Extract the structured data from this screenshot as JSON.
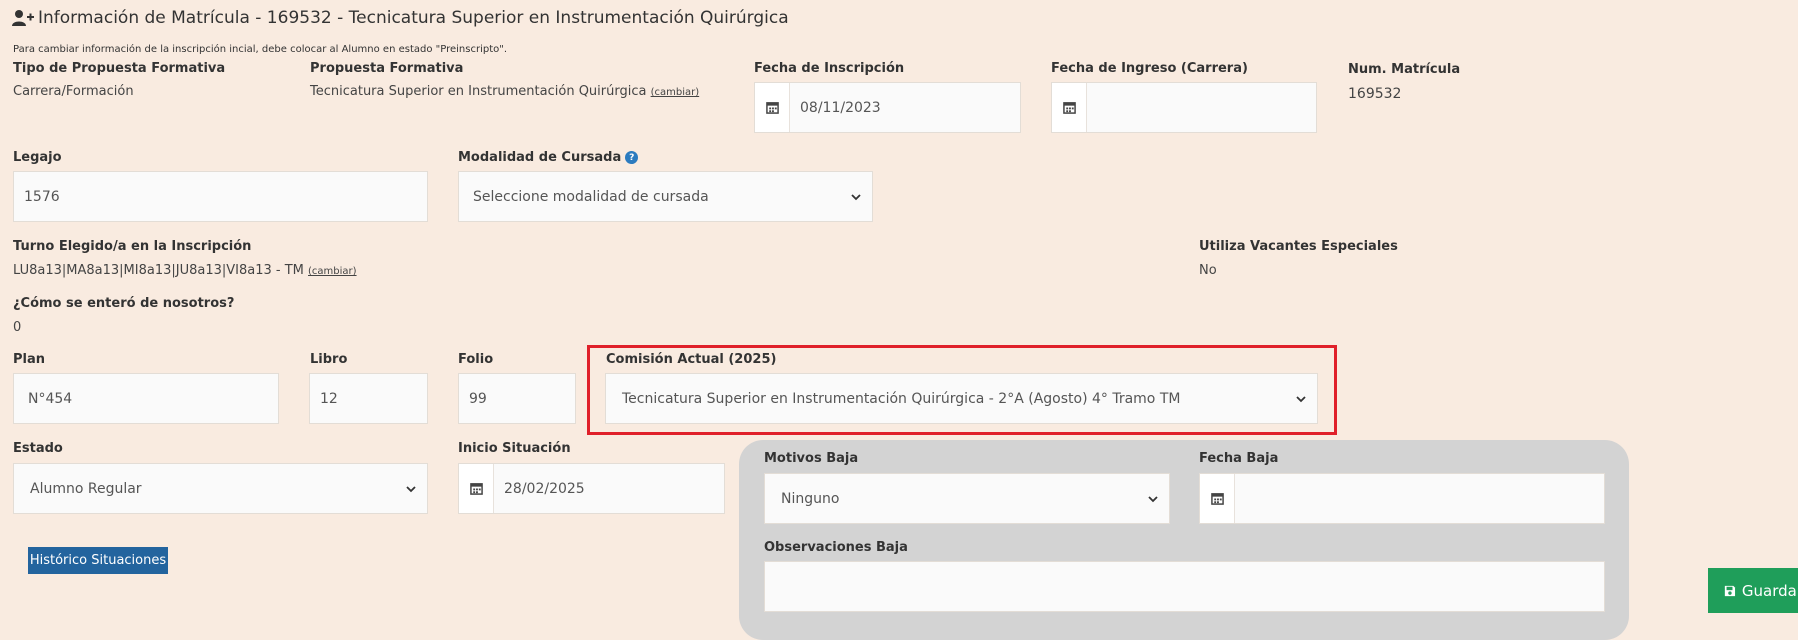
{
  "header": {
    "title": "Información de Matrícula - 169532 - Tecnicatura Superior en Instrumentación Quirúrgica",
    "note": "Para cambiar información de la inscripción incial, debe colocar al Alumno en estado \"Preinscripto\"."
  },
  "tipo_propuesta": {
    "label": "Tipo de Propuesta Formativa",
    "value": "Carrera/Formación"
  },
  "propuesta": {
    "label": "Propuesta Formativa",
    "value": "Tecnicatura Superior en Instrumentación Quirúrgica",
    "link": "(cambiar)"
  },
  "fecha_inscripcion": {
    "label": "Fecha de Inscripción",
    "value": "08/11/2023"
  },
  "fecha_ingreso": {
    "label": "Fecha de Ingreso (Carrera)",
    "value": ""
  },
  "num_matricula": {
    "label": "Num. Matrícula",
    "value": "169532"
  },
  "legajo": {
    "label": "Legajo",
    "value": "1576"
  },
  "modalidad": {
    "label": "Modalidad de Cursada",
    "help": "?",
    "value": "Seleccione modalidad de cursada"
  },
  "turno": {
    "label": "Turno Elegido/a en la Inscripción",
    "value": "LU8a13|MA8a13|MI8a13|JU8a13|VI8a13 - TM",
    "link": "(cambiar)"
  },
  "vacantes": {
    "label": "Utiliza Vacantes Especiales",
    "value": "No"
  },
  "como_entero": {
    "label": "¿Cómo se enteró de nosotros?",
    "value": "0"
  },
  "plan": {
    "label": "Plan",
    "value": "N°454"
  },
  "libro": {
    "label": "Libro",
    "value": "12"
  },
  "folio": {
    "label": "Folio",
    "value": "99"
  },
  "comision": {
    "label": "Comisión Actual (2025)",
    "value": "Tecnicatura Superior en Instrumentación Quirúrgica - 2°A (Agosto) 4° Tramo TM"
  },
  "estado": {
    "label": "Estado",
    "value": "Alumno Regular"
  },
  "inicio_situacion": {
    "label": "Inicio Situación",
    "value": "28/02/2025"
  },
  "motivos_baja": {
    "label": "Motivos Baja",
    "value": "Ninguno"
  },
  "fecha_baja": {
    "label": "Fecha Baja",
    "value": ""
  },
  "observaciones_baja": {
    "label": "Observaciones Baja",
    "value": ""
  },
  "buttons": {
    "historico": "Histórico Situaciones",
    "guardar": "Guardar"
  },
  "colors": {
    "background": "#f9ebe0",
    "highlight": "#e0202a",
    "primary": "#23649e",
    "success": "#1f9e5a",
    "panel": "#d3d3d3"
  }
}
